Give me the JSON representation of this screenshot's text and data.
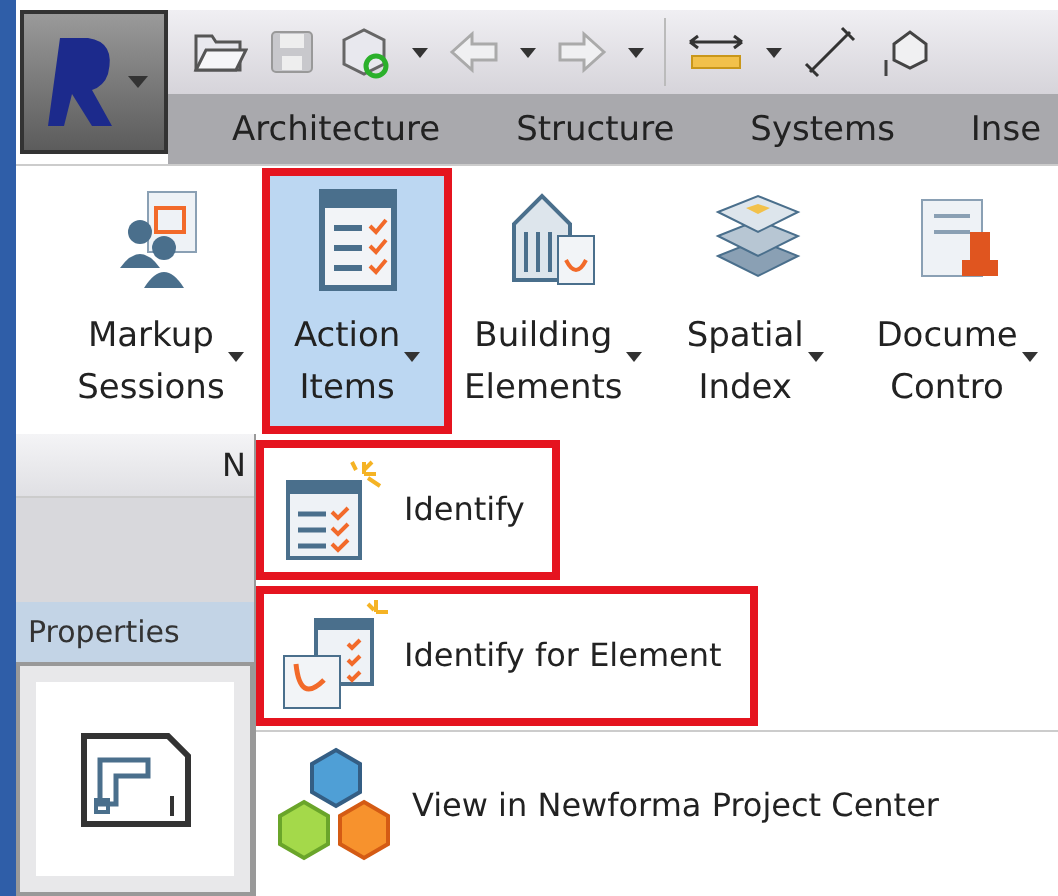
{
  "tabs": [
    {
      "label": "Architecture",
      "selected": false
    },
    {
      "label": "Structure",
      "selected": false
    },
    {
      "label": "Systems",
      "selected": false
    },
    {
      "label": "Inse",
      "selected": false
    }
  ],
  "ribbon_buttons": [
    {
      "kind": "markup",
      "line1": "Markup",
      "line2": "Sessions",
      "selected": false,
      "highlighted": false
    },
    {
      "kind": "action",
      "line1": "Action",
      "line2": "Items",
      "selected": true,
      "highlighted": true
    },
    {
      "kind": "building",
      "line1": "Building",
      "line2": "Elements",
      "selected": false,
      "highlighted": false
    },
    {
      "kind": "spatial",
      "line1": "Spatial",
      "line2": "Index",
      "selected": false,
      "highlighted": false
    },
    {
      "kind": "document",
      "line1": "Docume",
      "line2": "Contro",
      "selected": false,
      "highlighted": false
    }
  ],
  "panel_label": "N",
  "properties": {
    "title": "Properties"
  },
  "menu_items": [
    {
      "kind": "identify",
      "label": "Identify",
      "highlighted": true
    },
    {
      "kind": "identify_element",
      "label": "Identify for Element",
      "highlighted": true
    },
    {
      "kind": "view",
      "label": "View in Newforma Project Center",
      "highlighted": false
    }
  ]
}
